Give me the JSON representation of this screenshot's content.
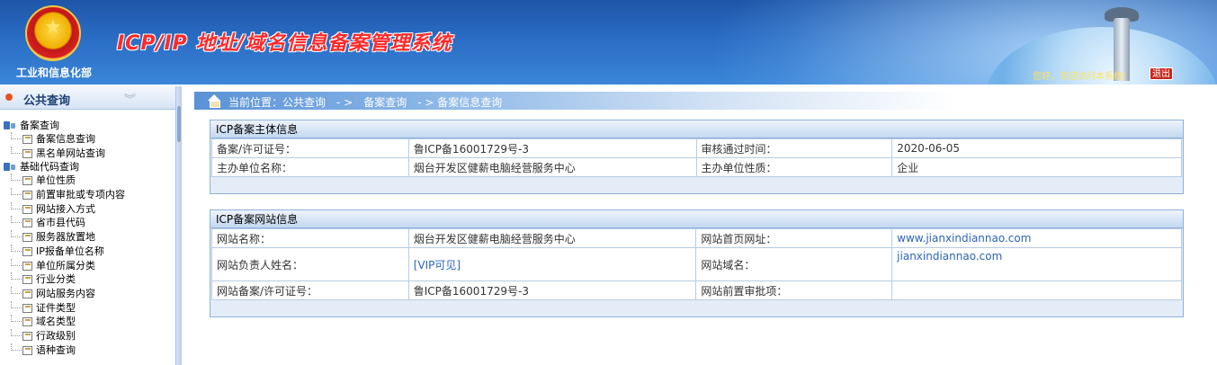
{
  "header": {
    "ministry": "工业和信息化部",
    "system_title": "ICP/IP 地址/域名信息备案管理系统",
    "welcome": "您好，欢迎访问本系统!",
    "logout_label": "退出"
  },
  "sidebar": {
    "title": "公共查询",
    "groups": [
      {
        "label": "备案查询",
        "items": [
          "备案信息查询",
          "黑名单网站查询"
        ]
      },
      {
        "label": "基础代码查询",
        "items": [
          "单位性质",
          "前置审批或专项内容",
          "网站接入方式",
          "省市县代码",
          "服务器放置地",
          "IP报备单位名称",
          "单位所属分类",
          "行业分类",
          "网站服务内容",
          "证件类型",
          "域名类型",
          "行政级别",
          "语种查询"
        ]
      }
    ]
  },
  "breadcrumb": "当前位置：公共查询　- >　备案查询　- > 备案信息查询",
  "subject_panel": {
    "title": "ICP备案主体信息",
    "rows": [
      {
        "label1": "备案/许可证号：",
        "value1": "鲁ICP备16001729号-3",
        "label2": "审核通过时间：",
        "value2": "2020-06-05"
      },
      {
        "label1": "主办单位名称：",
        "value1": "烟台开发区健薪电脑经营服务中心",
        "label2": "主办单位性质：",
        "value2": "企业"
      }
    ]
  },
  "website_panel": {
    "title": "ICP备案网站信息",
    "rows": [
      {
        "label1": "网站名称：",
        "value1": "烟台开发区健薪电脑经营服务中心",
        "label2": "网站首页网址：",
        "value2": "www.jianxindiannao.com"
      },
      {
        "label1": "网站负责人姓名：",
        "value1": "[VIP可见]",
        "label2": "网站域名：",
        "value2": "jianxindiannao.com"
      },
      {
        "label1": "网站备案/许可证号：",
        "value1": "鲁ICP备16001729号-3",
        "label2": "网站前置审批项：",
        "value2": ""
      }
    ]
  }
}
